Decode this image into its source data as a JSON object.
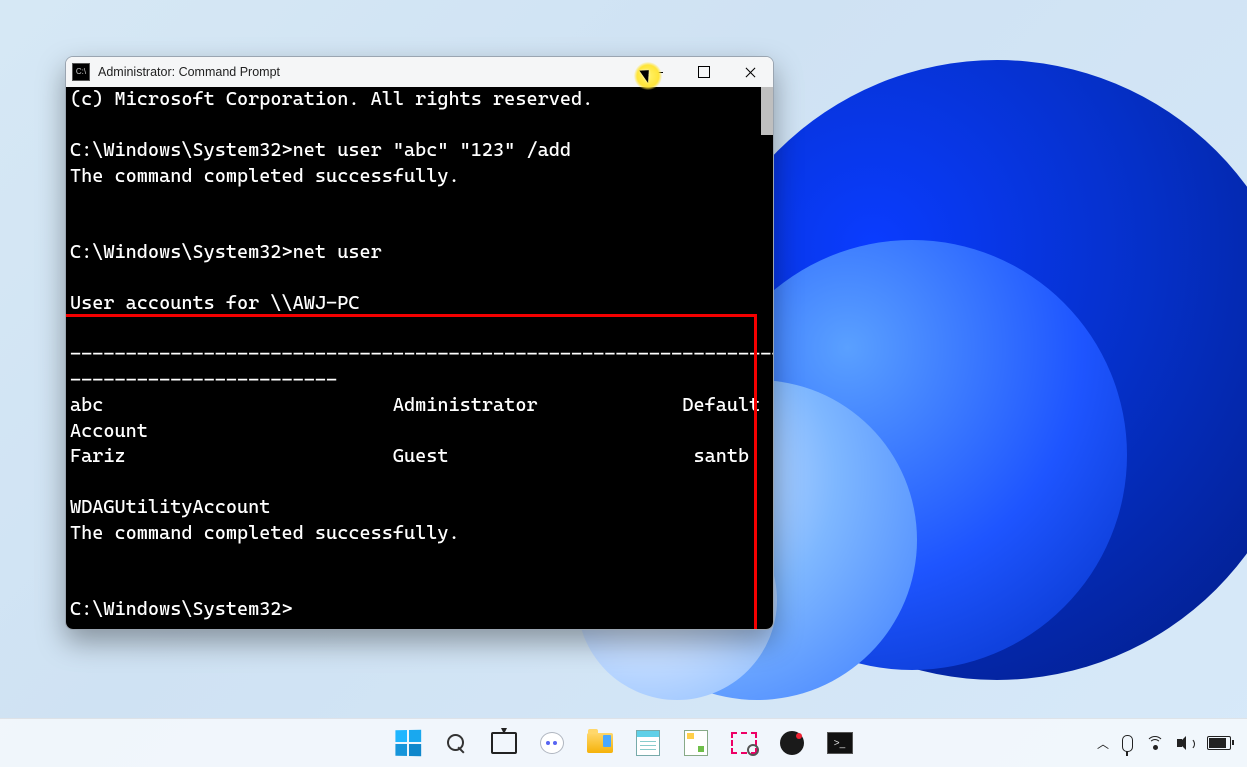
{
  "window": {
    "title": "Administrator: Command Prompt"
  },
  "terminal": {
    "line_copyright": "(c) Microsoft Corporation. All rights reserved.",
    "blank1": "",
    "line_cmd1": "C:\\Windows\\System32>net user \"abc\" \"123\" /add",
    "line_resp1": "The command completed successfully.",
    "blank2": "",
    "blank3": "",
    "line_cmd2": "C:\\Windows\\System32>net user",
    "blank4": "",
    "line_accounts_hdr": "User accounts for \\\\AWJ-PC",
    "blank5": "",
    "line_dash1": "-------------------------------------------------------------------",
    "line_dash2": "------------------------",
    "line_users_row1": "abc                          Administrator             Default",
    "line_users_row1b": "Account",
    "line_users_row2": "Fariz                        Guest                      santb",
    "blank6": "",
    "line_users_row3": "WDAGUtilityAccount",
    "line_resp2": "The command completed successfully.",
    "blank7": "",
    "blank8": "",
    "line_prompt": "C:\\Windows\\System32>"
  },
  "taskbar": {
    "start": "Start",
    "search": "Search",
    "taskview": "Task View",
    "chat": "Chat",
    "explorer": "File Explorer",
    "notepad": "Notepad",
    "paint": "Paint",
    "snip": "Snipping Tool",
    "obs": "OBS Studio",
    "terminal": "Command Prompt"
  },
  "tray": {
    "overflow": "Show hidden icons",
    "mic": "Microphone",
    "wifi": "Network",
    "volume": "Volume",
    "battery": "Battery"
  }
}
